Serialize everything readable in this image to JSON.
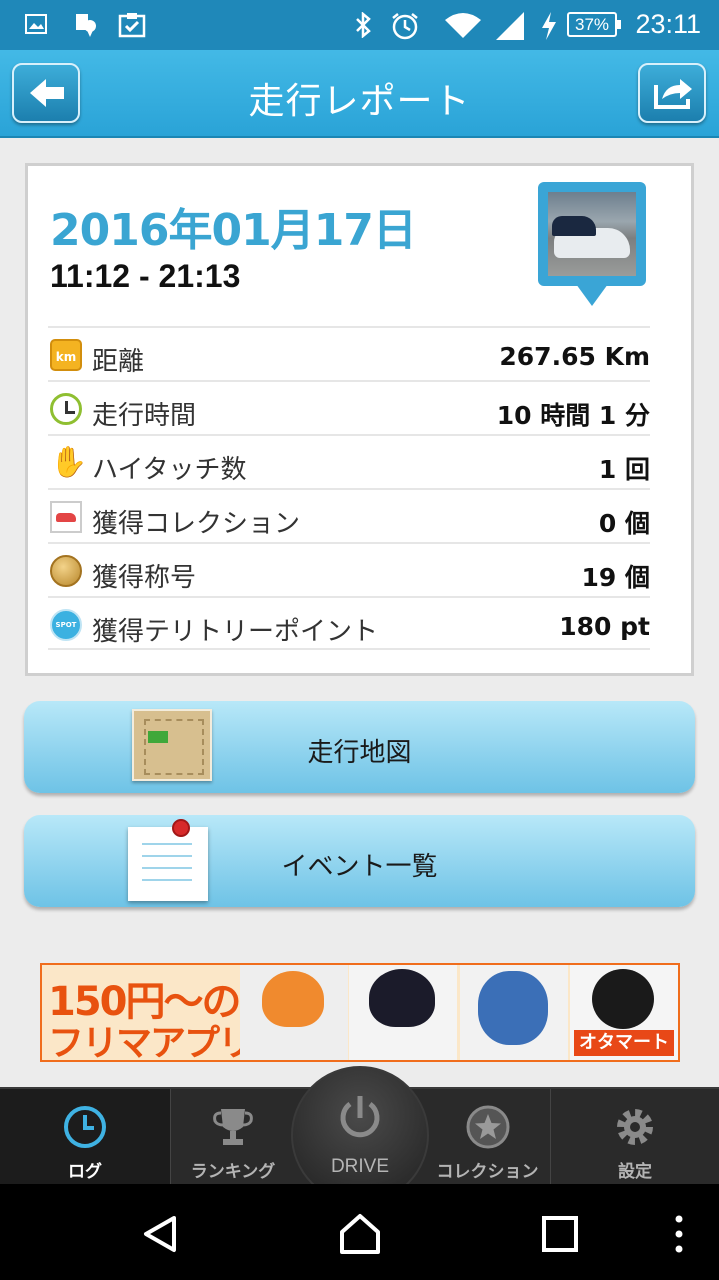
{
  "status_bar": {
    "time": "23:11",
    "battery": "37%",
    "icons": [
      "image-icon",
      "location-icon",
      "clipboard-icon",
      "bluetooth-icon",
      "alarm-icon",
      "wifi-icon",
      "signal-icon",
      "charging-icon"
    ]
  },
  "header": {
    "title": "走行レポート",
    "back_icon": "back-arrow-icon",
    "share_icon": "share-icon"
  },
  "report": {
    "date": "2016年01月17日",
    "time_range": "11:12 - 21:13",
    "stats": [
      {
        "icon": "km-icon",
        "icon_text": "km",
        "label": "距離",
        "value": "267.65 Km"
      },
      {
        "icon": "clock-icon",
        "label": "走行時間",
        "value": "10 時間 1 分"
      },
      {
        "icon": "hand-icon",
        "label": "ハイタッチ数",
        "value": "1 回"
      },
      {
        "icon": "car-icon",
        "label": "獲得コレクション",
        "value": "0 個"
      },
      {
        "icon": "medal-icon",
        "label": "獲得称号",
        "value": "19 個"
      },
      {
        "icon": "spot-icon",
        "icon_text": "SPOT",
        "label": "獲得テリトリーポイント",
        "value": "180 pt"
      }
    ]
  },
  "buttons": {
    "map_label": "走行地図",
    "events_label": "イベント一覧"
  },
  "banner": {
    "line1": "150円～の",
    "line2": "フリマアプリ",
    "logo": "オタマート"
  },
  "tabs": {
    "log": "ログ",
    "ranking": "ランキング",
    "drive": "DRIVE",
    "collection": "コレクション",
    "settings": "設定"
  },
  "colors": {
    "header": "#2aa3d7",
    "status_bar": "#1f88b9",
    "date": "#3aa5d2",
    "button": "#8fd3ee",
    "banner_accent": "#e8520f",
    "tabbar": "#2a2a2a"
  }
}
